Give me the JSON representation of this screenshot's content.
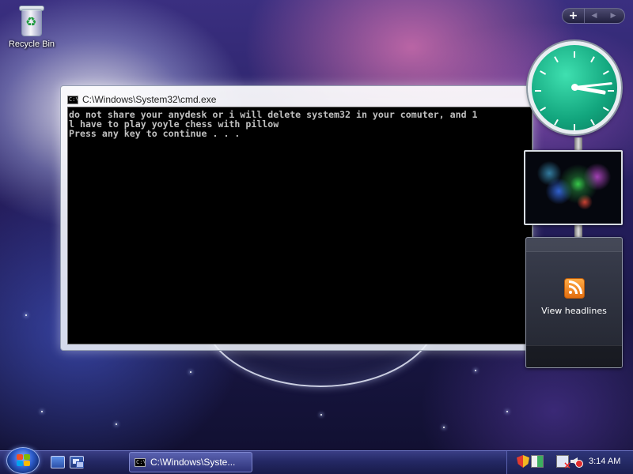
{
  "desktop": {
    "recycle_bin_label": "Recycle Bin"
  },
  "cmd_window": {
    "title": "C:\\Windows\\System32\\cmd.exe",
    "icon_text": "C:\\",
    "lines": [
      "do not share your anydesk or i will delete system32 in your comuter, and 1",
      "l have to play yoyle chess with pillow",
      "Press any key to continue . . ."
    ]
  },
  "sidebar": {
    "toolbar": {
      "add_label": "+",
      "prev_label": "◀",
      "next_label": "▶"
    },
    "clock": {
      "hour": 3,
      "minute": 14
    },
    "feed": {
      "label": "View headlines"
    }
  },
  "taskbar": {
    "active_task_label": "C:\\Windows\\Syste...",
    "task_icon_text": "C:\\",
    "clock": "3:14 AM"
  },
  "icons": {
    "start": "windows-flag-icon",
    "show_desktop": "show-desktop-icon",
    "switch_windows": "switch-windows-icon",
    "cmd": "command-prompt-icon",
    "rss": "rss-feed-icon",
    "shield": "security-shield-icon",
    "safety": "safely-remove-icon",
    "network": "network-disconnected-icon",
    "volume": "volume-muted-icon"
  },
  "colors": {
    "clock_face": "#12a57d",
    "console_bg": "#000000",
    "console_text": "#c0c0c0",
    "taskbar": "#242864",
    "rss_orange": "#f08a24"
  }
}
